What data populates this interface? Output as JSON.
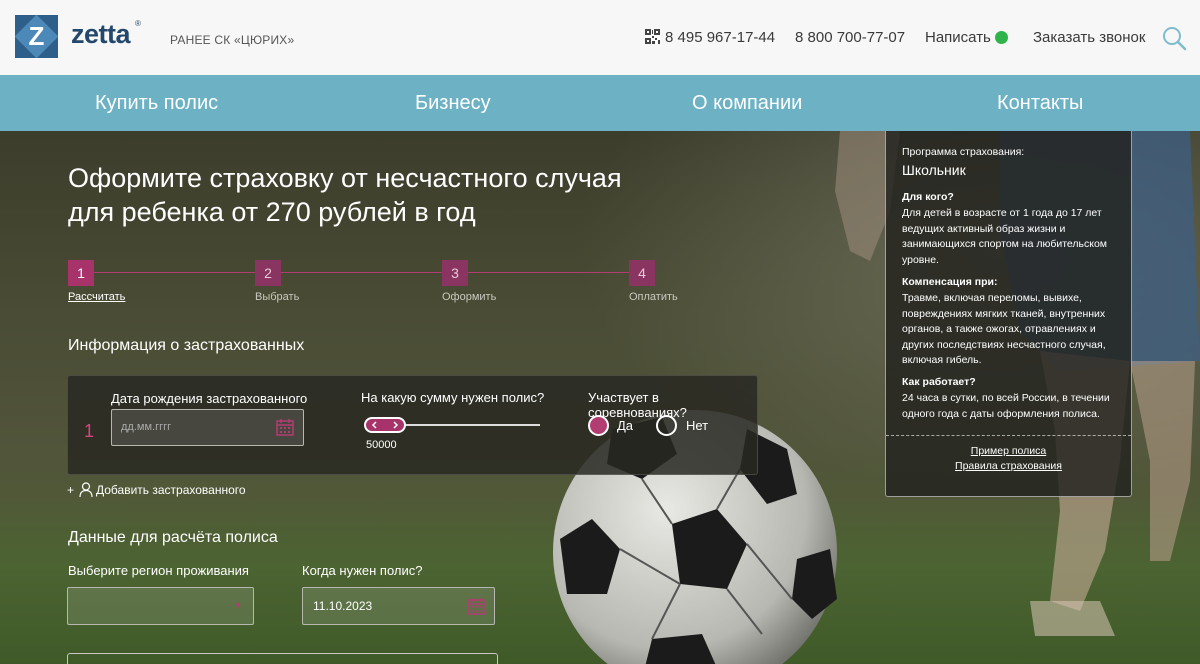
{
  "header": {
    "logo_letter": "Z",
    "logo_text": "zetta",
    "logo_tm": "®",
    "formerly": "РАНЕЕ СК «ЦЮРИХ»",
    "phone1": "8 495 967-17-44",
    "phone2": "8 800 700-77-07",
    "write_label": "Написать",
    "callback_label": "Заказать звонок"
  },
  "nav": {
    "items": [
      {
        "label": "Купить полис"
      },
      {
        "label": "Бизнесу"
      },
      {
        "label": "О компании"
      },
      {
        "label": "Контакты"
      }
    ]
  },
  "hero": {
    "headline_line1": "Оформите страховку от несчастного случая",
    "headline_line2": "для ребенка от 270 рублей в год"
  },
  "steps": [
    {
      "number": "1",
      "label": "Рассчитать"
    },
    {
      "number": "2",
      "label": "Выбрать"
    },
    {
      "number": "3",
      "label": "Оформить"
    },
    {
      "number": "4",
      "label": "Оплатить"
    }
  ],
  "insured": {
    "section_title": "Информация о застрахованных",
    "row_number": "1",
    "birth_label": "Дата рождения застрахованного",
    "birth_placeholder": "дд.мм.гггг",
    "sum_label": "На какую сумму нужен полис?",
    "sum_value": "50000",
    "competition_label": "Участвует в соревнованиях?",
    "yes_label": "Да",
    "no_label": "Нет",
    "competition_selected": "Да",
    "add_plus": "+",
    "add_label": "Добавить застрахованного"
  },
  "policy_data": {
    "section_title": "Данные для расчёта полиса",
    "region_label": "Выберите регион проживания",
    "region_value": "",
    "select_arrow": "▼",
    "when_label": "Когда нужен полис?",
    "when_value": "11.10.2023"
  },
  "info_panel": {
    "program_caption": "Программа страхования:",
    "program_name": "Школьник",
    "for_whom_title": "Для кого?",
    "for_whom_text": "Для детей в возрасте от 1 года до 17 лет ведущих активный образ жизни и занимающихся спортом на любительском уровне.",
    "compensation_title": "Компенсация при:",
    "compensation_text": "Травме, включая переломы, вывихе, повреждениях мягких тканей, внутренних органов, а также ожогах, отравлениях и других последствиях несчастного случая, включая гибель.",
    "how_title": "Как работает?",
    "how_text": "24 часа в сутки, по всей России, в течении одного года с даты оформления полиса.",
    "link_example": "Пример полиса",
    "link_rules": "Правила страхования"
  },
  "colors": {
    "nav_bg": "#6db1c4",
    "accent": "#a8336a",
    "brand_blue": "#24486b",
    "whatsapp": "#2fb34b"
  },
  "icons": [
    "qr-code-icon",
    "whatsapp-icon",
    "search-icon",
    "calendar-icon",
    "person-icon",
    "slider-arrows-icon"
  ]
}
